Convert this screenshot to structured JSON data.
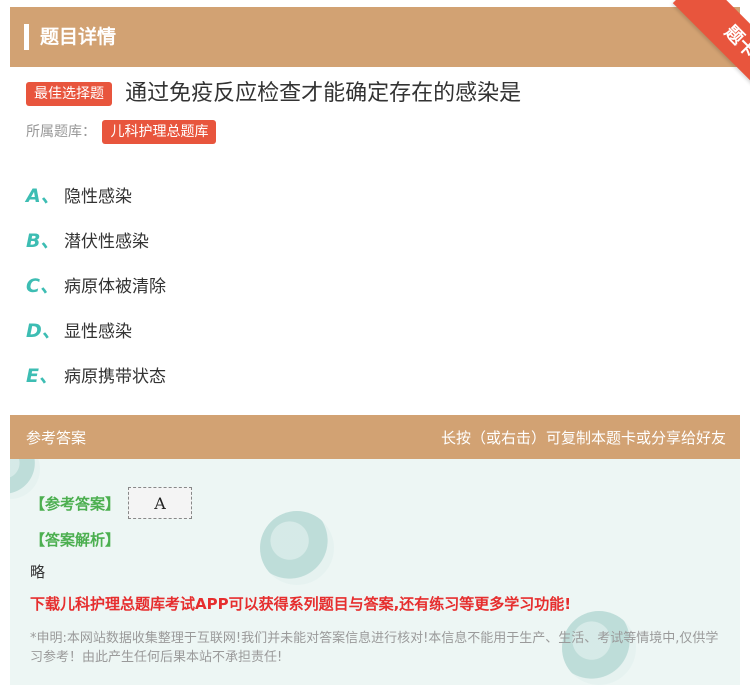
{
  "header": {
    "title": "题目详情"
  },
  "ribbon": {
    "label": "题卡"
  },
  "question": {
    "type_tag": "最佳选择题",
    "text": "通过免疫反应检查才能确定存在的感染是",
    "bank_label": "所属题库：",
    "bank_name": "儿科护理总题库"
  },
  "options": [
    {
      "letter": "A、",
      "text": "隐性感染"
    },
    {
      "letter": "B、",
      "text": "潜伏性感染"
    },
    {
      "letter": "C、",
      "text": "病原体被清除"
    },
    {
      "letter": "D、",
      "text": "显性感染"
    },
    {
      "letter": "E、",
      "text": "病原携带状态"
    }
  ],
  "answer_header": {
    "left": "参考答案",
    "right": "长按（或右击）可复制本题卡或分享给好友"
  },
  "answer": {
    "label": "【参考答案】",
    "value": "A",
    "analysis_label": "【答案解析】",
    "analysis_text": "略",
    "download_text": "下载儿科护理总题库考试APP可以获得系列题目与答案,还有练习等更多学习功能!",
    "disclaimer": "*申明:本网站数据收集整理于互联网!我们并未能对答案信息进行核对!本信息不能用于生产、生活、考试等情境中,仅供学习参考！由此产生任何后果本站不承担责任!"
  },
  "colors": {
    "header_bg": "#d2a273",
    "accent_red": "#e8553d",
    "option_letter": "#3dbdb3",
    "answer_green": "#4caf50",
    "download_red": "#e62e2e",
    "panel_bg": "#edf6f4"
  }
}
